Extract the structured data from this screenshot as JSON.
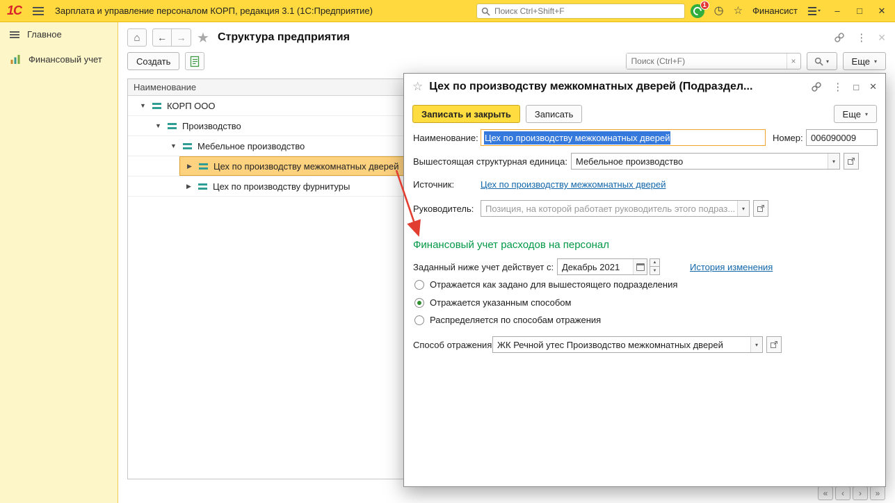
{
  "topbar": {
    "logo": "1С",
    "title": "Зарплата и управление персоналом КОРП, редакция 3.1  (1С:Предприятие)",
    "search_placeholder": "Поиск Ctrl+Shift+F",
    "notification_count": "1",
    "user": "Финансист"
  },
  "sidebar": {
    "items": [
      {
        "label": "Главное"
      },
      {
        "label": "Финансовый учет"
      }
    ]
  },
  "main": {
    "title": "Структура предприятия",
    "toolbar": {
      "create_label": "Создать",
      "search_placeholder": "Поиск (Ctrl+F)",
      "more_label": "Еще"
    },
    "tree": {
      "header": "Наименование",
      "rows": [
        {
          "label": "КОРП ООО",
          "level": 0,
          "expanded": true,
          "selected": false
        },
        {
          "label": "Производство",
          "level": 1,
          "expanded": true,
          "selected": false
        },
        {
          "label": "Мебельное производство",
          "level": 2,
          "expanded": true,
          "selected": false
        },
        {
          "label": "Цех по производству межкомнатных дверей",
          "level": 3,
          "expanded": false,
          "selected": true
        },
        {
          "label": "Цех по производству фурнитуры",
          "level": 3,
          "expanded": false,
          "selected": false
        }
      ]
    }
  },
  "dialog": {
    "title": "Цех по производству межкомнатных дверей (Подраздел...",
    "save_close_label": "Записать и закрыть",
    "save_label": "Записать",
    "more_label": "Еще",
    "fields": {
      "name_label": "Наименование:",
      "name_value": "Цех по производству межкомнатных дверей",
      "number_label": "Номер:",
      "number_value": "006090009",
      "parent_label": "Вышестоящая структурная единица:",
      "parent_value": "Мебельное производство",
      "source_label": "Источник:",
      "source_link": "Цех по производству межкомнатных дверей",
      "manager_label": "Руководитель:",
      "manager_placeholder": "Позиция, на которой работает руководитель этого подраз..."
    },
    "section": {
      "title": "Финансовый учет расходов на персонал",
      "date_label": "Заданный ниже учет действует с:",
      "date_value": "Декабрь 2021",
      "history_link": "История изменения",
      "radios": [
        {
          "label": "Отражается как задано для вышестоящего подразделения",
          "checked": false
        },
        {
          "label": "Отражается указанным способом",
          "checked": true
        },
        {
          "label": "Распределяется по способам отражения",
          "checked": false
        }
      ],
      "method_label": "Способ отражения:",
      "method_value": "ЖК Речной утес Производство межкомнатных дверей"
    }
  },
  "colors": {
    "topbar_yellow": "#ffd93d",
    "sidebar_yellow": "#fdf6c9",
    "selected_row": "#ffd27f",
    "primary_button": "#ffdc3f",
    "section_green": "#009845",
    "link_blue": "#1166aa",
    "annotation_red": "#e13d30"
  },
  "icons": {
    "home": "⌂",
    "back": "←",
    "forward": "→",
    "star_filled": "★",
    "star_outline": "☆",
    "kebab": "⋮",
    "close": "✕",
    "minimize": "–",
    "maximize": "□",
    "caret_down": "▾",
    "clear": "×",
    "clock": "◷",
    "tree_expanded": "▼",
    "tree_collapsed": "▶",
    "spin_up": "▲",
    "spin_down": "▼",
    "pager_first": "«",
    "pager_prev": "‹",
    "pager_next": "›",
    "pager_last": "»"
  }
}
